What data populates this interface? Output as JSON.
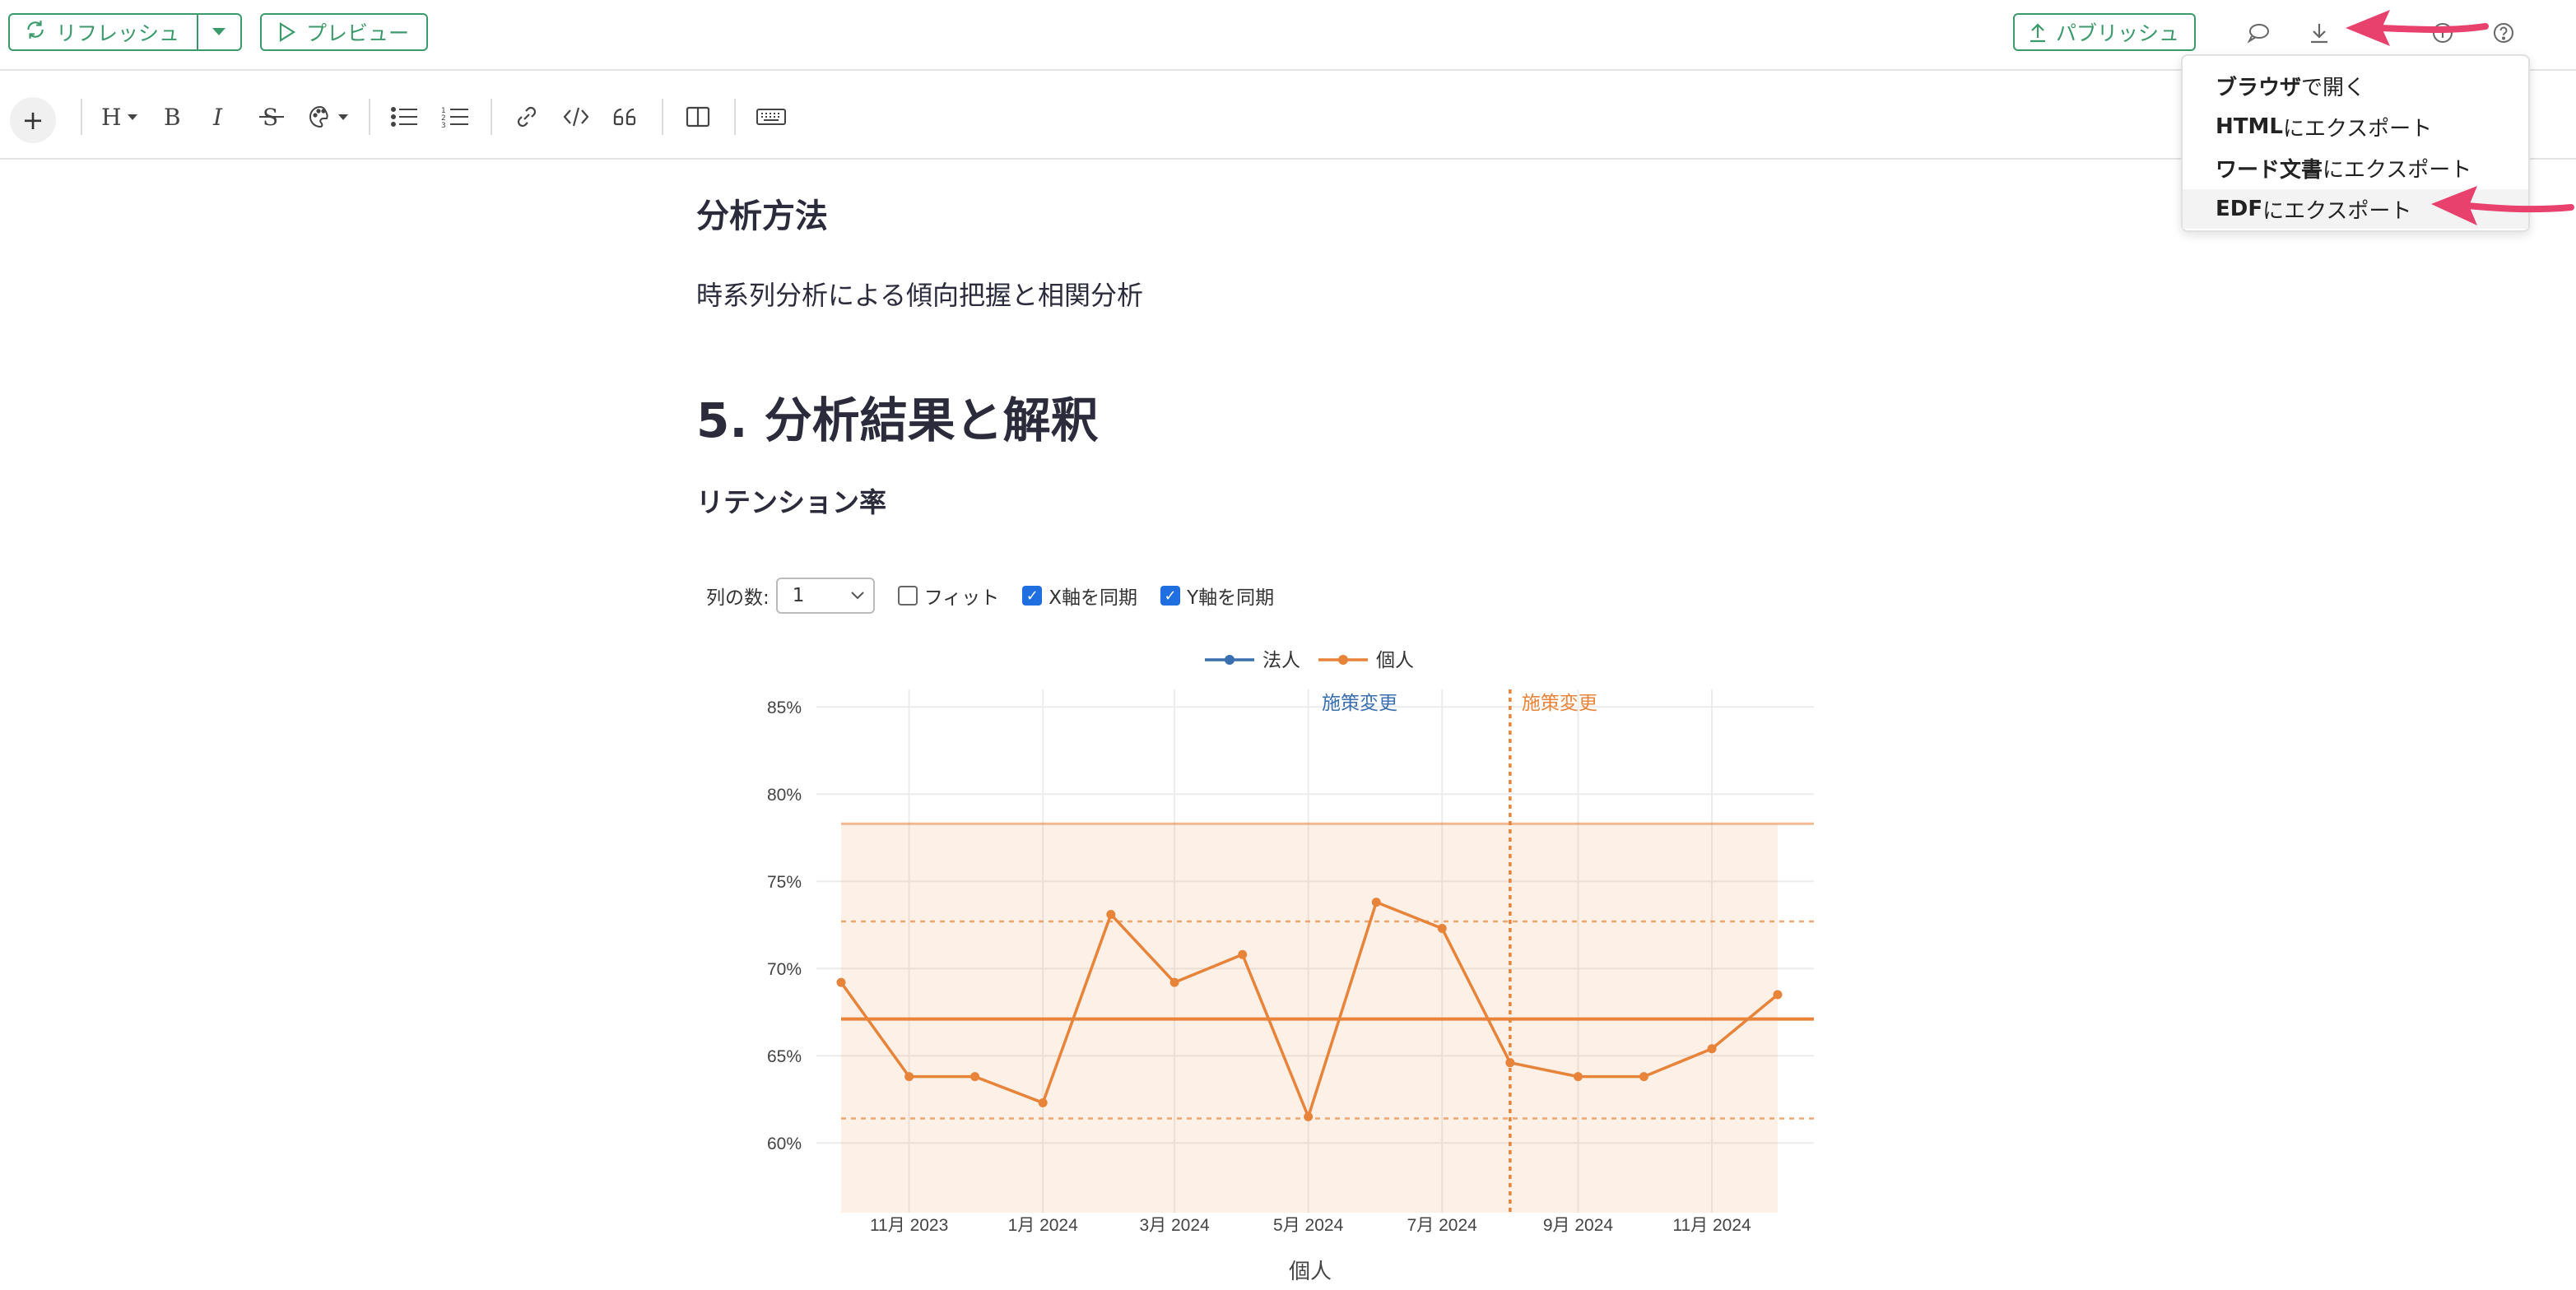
{
  "toolbar": {
    "refresh_label": "リフレッシュ",
    "preview_label": "プレビュー",
    "publish_label": "パブリッシュ"
  },
  "menu": {
    "items": [
      {
        "bold": "ブラウザ",
        "rest": "で開く"
      },
      {
        "bold": "HTML",
        "rest": "にエクスポート"
      },
      {
        "bold": "ワード文書",
        "rest": "にエクスポート"
      },
      {
        "bold": "EDF",
        "rest": "にエクスポート"
      }
    ]
  },
  "doc": {
    "method_heading": "分析方法",
    "method_text": "時系列分析による傾向把握と相関分析",
    "result_heading": "5. 分析結果と解釈",
    "retention_heading": "リテンション率"
  },
  "controls": {
    "columns_label": "列の数:",
    "columns_value": "1",
    "fit_label": "フィット",
    "fit_checked": false,
    "sync_x_label": "X軸を同期",
    "sync_x_checked": true,
    "sync_y_label": "Y軸を同期",
    "sync_y_checked": true
  },
  "chart_data": {
    "type": "line",
    "xlabel": "個人",
    "legend": [
      "法人",
      "個人"
    ],
    "legend_position": "top-center",
    "colors": {
      "法人": "#3a6fb0",
      "個人": "#e8843a"
    },
    "x_ticks": [
      "11月 2023",
      "1月 2024",
      "3月 2024",
      "5月 2024",
      "7月 2024",
      "9月 2024",
      "11月 2024"
    ],
    "y_ticks": [
      "60%",
      "65%",
      "70%",
      "75%",
      "80%",
      "85%"
    ],
    "ylim": [
      56,
      86
    ],
    "series": [
      {
        "name": "個人",
        "x": [
          "2023-10-01",
          "2023-11-01",
          "2023-12-01",
          "2024-01-01",
          "2024-02-01",
          "2024-03-01",
          "2024-04-01",
          "2024-05-01",
          "2024-06-01",
          "2024-07-01",
          "2024-08-01",
          "2024-09-01",
          "2024-10-01",
          "2024-11-01",
          "2024-12-01"
        ],
        "y": [
          69.2,
          63.8,
          63.8,
          62.3,
          73.1,
          69.2,
          70.8,
          61.5,
          73.8,
          72.3,
          64.6,
          63.8,
          63.8,
          65.4,
          68.5
        ]
      }
    ],
    "control_limits": {
      "center": 67.1,
      "upper_band": 78.3,
      "lower_band": 56.0,
      "upper_sigma": 72.7,
      "lower_sigma": 61.4
    },
    "annotations": [
      {
        "text": "施策変更",
        "series": "法人"
      },
      {
        "text": "施策変更",
        "series": "個人",
        "x": "2024-08-01"
      }
    ]
  }
}
